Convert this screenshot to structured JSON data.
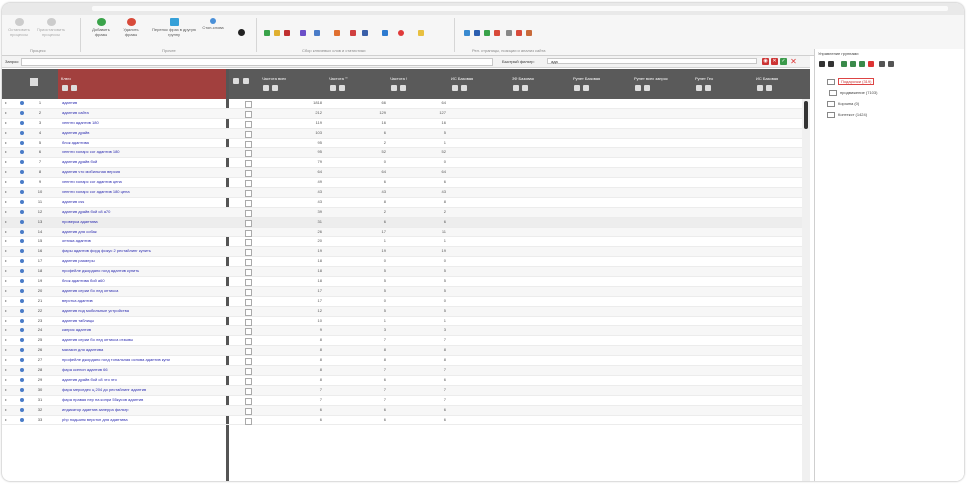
{
  "ribbon": {
    "groups": [
      "Процесс",
      "Прочее",
      "Сбор ключевых слов и статистики",
      "Рел. страницы, позиции и анализ сайта"
    ],
    "buttons": [
      {
        "label": "Остановить процессы",
        "icon": "stop-icon",
        "enabled": false
      },
      {
        "label": "Приостановить процессы",
        "icon": "pause-icon",
        "enabled": false
      },
      {
        "label": "Добавить фразы",
        "icon": "add-phrases-icon",
        "enabled": true
      },
      {
        "label": "Удалить фразы",
        "icon": "delete-phrases-icon",
        "enabled": true
      },
      {
        "label": "Перенос фраз в другую группу",
        "icon": "move-phrases-icon",
        "enabled": true
      },
      {
        "label": "Стоп-слова",
        "icon": "stopwords-icon",
        "enabled": true
      }
    ]
  },
  "query": {
    "label": "Запрос:",
    "value": "",
    "filter_label": "Быстрый фильтр:",
    "filter_value": "ада"
  },
  "colors": {
    "key_header": "#a2403e",
    "header": "#5a5a5a",
    "link": "#2b2bb0",
    "selected_group": "#d44444"
  },
  "columns": [
    "Ключ",
    "Частота всех",
    "Частота \"\"",
    "Частота !",
    "ИС Базовая",
    "ЗФ Базовая",
    "Рунет Базовая",
    "Рунет всех запрос",
    "Рунет Гео",
    "ИС Базовая"
  ],
  "rows": [
    {
      "n": "1",
      "kw": "адаптив",
      "f1": "1818",
      "f2": "66",
      "f3": "64"
    },
    {
      "n": "2",
      "kw": "адаптив сайта",
      "f1": "212",
      "f2": "129",
      "f3": "127"
    },
    {
      "n": "3",
      "kw": "хеннти адаптив 180",
      "f1": "119",
      "f2": "16",
      "f3": "16"
    },
    {
      "n": "4",
      "kw": "адаптив драйв",
      "f1": "103",
      "f2": "6",
      "f3": "5"
    },
    {
      "n": "5",
      "kw": "блок адаптива",
      "f1": "95",
      "f2": "2",
      "f3": "1"
    },
    {
      "n": "6",
      "kw": "хеннти холарс сог адаптив 180",
      "f1": "95",
      "f2": "52",
      "f3": "52"
    },
    {
      "n": "7",
      "kw": "адаптив драйв бой",
      "f1": "79",
      "f2": "0",
      "f3": "0"
    },
    {
      "n": "8",
      "kw": "адаптив что мобильная версия",
      "f1": "64",
      "f2": "64",
      "f3": "64"
    },
    {
      "n": "9",
      "kw": "хеннти холарс сог адаптив цена",
      "f1": "49",
      "f2": "6",
      "f3": "6"
    },
    {
      "n": "10",
      "kw": "хеннти холарс сог адаптив 180 цена",
      "f1": "43",
      "f2": "43",
      "f3": "43"
    },
    {
      "n": "11",
      "kw": "адаптив css",
      "f1": "43",
      "f2": "8",
      "f3": "8"
    },
    {
      "n": "12",
      "kw": "адаптив драйв бой с8 а70",
      "f1": "39",
      "f2": "2",
      "f3": "2"
    },
    {
      "n": "13",
      "kw": "проверка адаптива",
      "f1": "31",
      "f2": "6",
      "f3": "6"
    },
    {
      "n": "14",
      "kw": "адаптив для собак",
      "f1": "26",
      "f2": "17",
      "f3": "11"
    },
    {
      "n": "15",
      "kw": "оптика адаптив",
      "f1": "20",
      "f2": "1",
      "f3": "1"
    },
    {
      "n": "16",
      "kw": "фары адаптив форд фокус 2 рестайлинг купить",
      "f1": "19",
      "f2": "19",
      "f3": "19"
    },
    {
      "n": "17",
      "kw": "адаптив размеры",
      "f1": "18",
      "f2": "0",
      "f3": "0"
    },
    {
      "n": "18",
      "kw": "профейле джордано голд адаптив купить",
      "f1": "18",
      "f2": "5",
      "f3": "5"
    },
    {
      "n": "19",
      "kw": "блок адаптива бой а60",
      "f1": "18",
      "f2": "5",
      "f3": "5"
    },
    {
      "n": "20",
      "kw": "адаптив серии бо лед оптикса",
      "f1": "17",
      "f2": "5",
      "f3": "5"
    },
    {
      "n": "21",
      "kw": "верстка адаптив",
      "f1": "17",
      "f2": "0",
      "f3": "0"
    },
    {
      "n": "22",
      "kw": "адаптив под мобильные устройства",
      "f1": "12",
      "f2": "5",
      "f3": "5"
    },
    {
      "n": "23",
      "kw": "адаптив таблицы",
      "f1": "10",
      "f2": "1",
      "f3": "1"
    },
    {
      "n": "24",
      "kw": "каприс адаптив",
      "f1": "9",
      "f2": "3",
      "f3": "3"
    },
    {
      "n": "25",
      "kw": "адаптив серии бо лед оптикса отзывы",
      "f1": "8",
      "f2": "7",
      "f3": "7"
    },
    {
      "n": "26",
      "kw": "магазин для адаптива",
      "f1": "8",
      "f2": "8",
      "f3": "8"
    },
    {
      "n": "27",
      "kw": "профейле джордано голд тональная основа адаптив купи",
      "f1": "8",
      "f2": "8",
      "f3": "8"
    },
    {
      "n": "28",
      "kw": "фара ксенон адаптив 66",
      "f1": "8",
      "f2": "7",
      "f3": "7"
    },
    {
      "n": "29",
      "kw": "адаптив драйв бой с8 что это",
      "f1": "8",
      "f2": "6",
      "f3": "6"
    },
    {
      "n": "30",
      "kw": "фара мерседес ц 204 до рестайлинг адаптив",
      "f1": "7",
      "f2": "7",
      "f3": "7"
    },
    {
      "n": "31",
      "kw": "фара правая пер на конри 55кусов адаптив",
      "f1": "7",
      "f2": "7",
      "f3": "7"
    },
    {
      "n": "32",
      "kw": "индикатор адаптив заперра фильтр",
      "f1": "6",
      "f2": "6",
      "f3": "6"
    },
    {
      "n": "33",
      "kw": "php подшипк версткн для адаптива",
      "f1": "6",
      "f2": "6",
      "f3": "6"
    }
  ],
  "groups_panel": {
    "title": "Управление группами",
    "items": [
      {
        "label": "Подарочки (319)",
        "selected": true
      },
      {
        "label": "продвижение (7103)",
        "selected": false
      },
      {
        "label": "Корзина (0)",
        "selected": false
      },
      {
        "label": "Контекст (1424)",
        "selected": false
      }
    ]
  }
}
